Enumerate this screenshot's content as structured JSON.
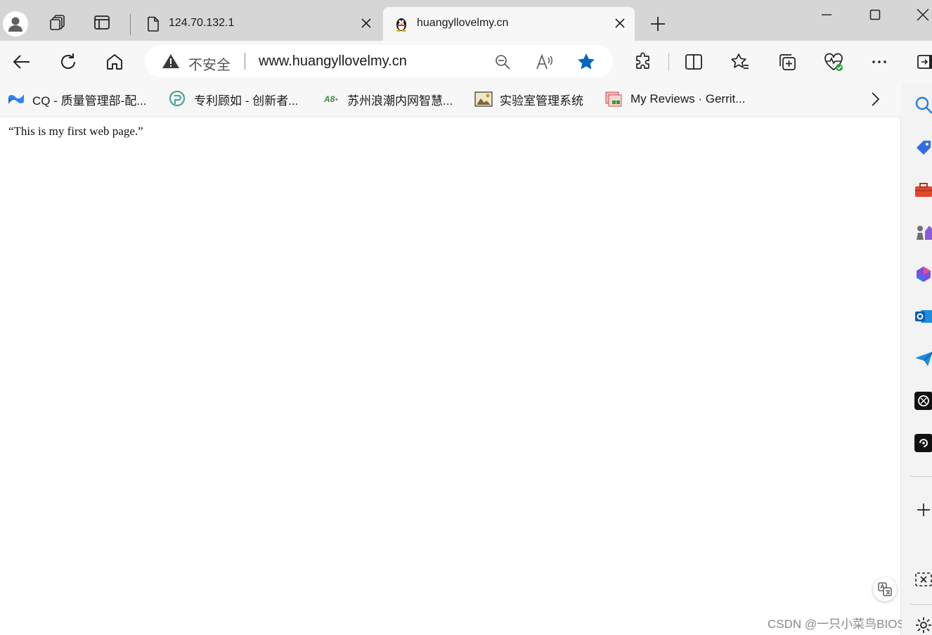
{
  "tabs": [
    {
      "title": "124.70.132.1",
      "icon": "page-icon"
    },
    {
      "title": "huangyllovelmy.cn",
      "icon": "qq-penguin-icon"
    }
  ],
  "address_bar": {
    "security_label": "不安全",
    "url": "www.huangyllovelmy.cn"
  },
  "favorites": [
    {
      "label": "CQ - 质量管理部-配...",
      "icon": "confluence-icon"
    },
    {
      "label": "专利顾如 - 创新者...",
      "icon": "patent-search-icon"
    },
    {
      "label": "苏州浪潮内网智慧...",
      "icon": "a8-icon"
    },
    {
      "label": "实验室管理系统",
      "icon": "lab-system-icon"
    },
    {
      "label": "My Reviews · Gerrit...",
      "icon": "gerrit-icon"
    }
  ],
  "page": {
    "body_text": "“This is my first web page.”"
  },
  "watermark": "CSDN @一只小菜鸟BIOS",
  "colors": {
    "favorite_star": "#0067c0",
    "titlebar": "#d6d6d6",
    "toolbar": "#f7f7f7"
  }
}
